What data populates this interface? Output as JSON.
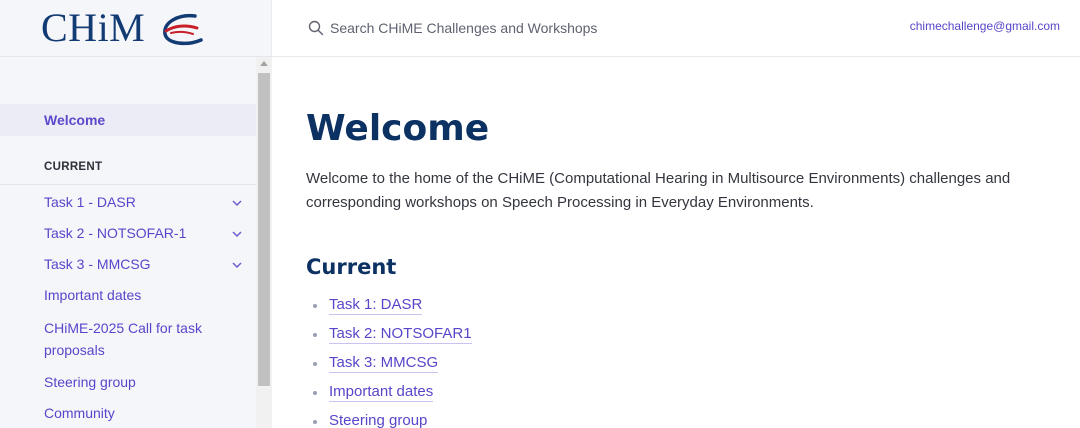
{
  "brand": {
    "logo_text": "CHiM"
  },
  "header": {
    "search_placeholder": "Search CHiME Challenges and Workshops",
    "email": "chimechallenge@gmail.com"
  },
  "sidebar": {
    "active_item": "Welcome",
    "section_label": "CURRENT",
    "items": [
      {
        "label": "Task 1 - DASR",
        "expandable": true
      },
      {
        "label": "Task 2 - NOTSOFAR-1",
        "expandable": true
      },
      {
        "label": "Task 3 - MMCSG",
        "expandable": true
      },
      {
        "label": "Important dates",
        "expandable": false
      },
      {
        "label": "CHiME-2025 Call for task proposals",
        "expandable": false
      },
      {
        "label": "Steering group",
        "expandable": false
      },
      {
        "label": "Community",
        "expandable": false
      }
    ]
  },
  "main": {
    "title": "Welcome",
    "intro": "Welcome to the home of the CHiME (Computational Hearing in Multisource Environments) challenges and corresponding workshops on Speech Processing in Everyday Environments.",
    "section_title": "Current",
    "links": [
      "Task 1: DASR",
      "Task 2: NOTSOFAR1",
      "Task 3: MMCSG",
      "Important dates",
      "Steering group"
    ]
  },
  "colors": {
    "brand_navy": "#0c3163",
    "link_purple": "#5746c9",
    "logo_red": "#c8202a",
    "sidebar_bg": "#f5f6fa"
  }
}
